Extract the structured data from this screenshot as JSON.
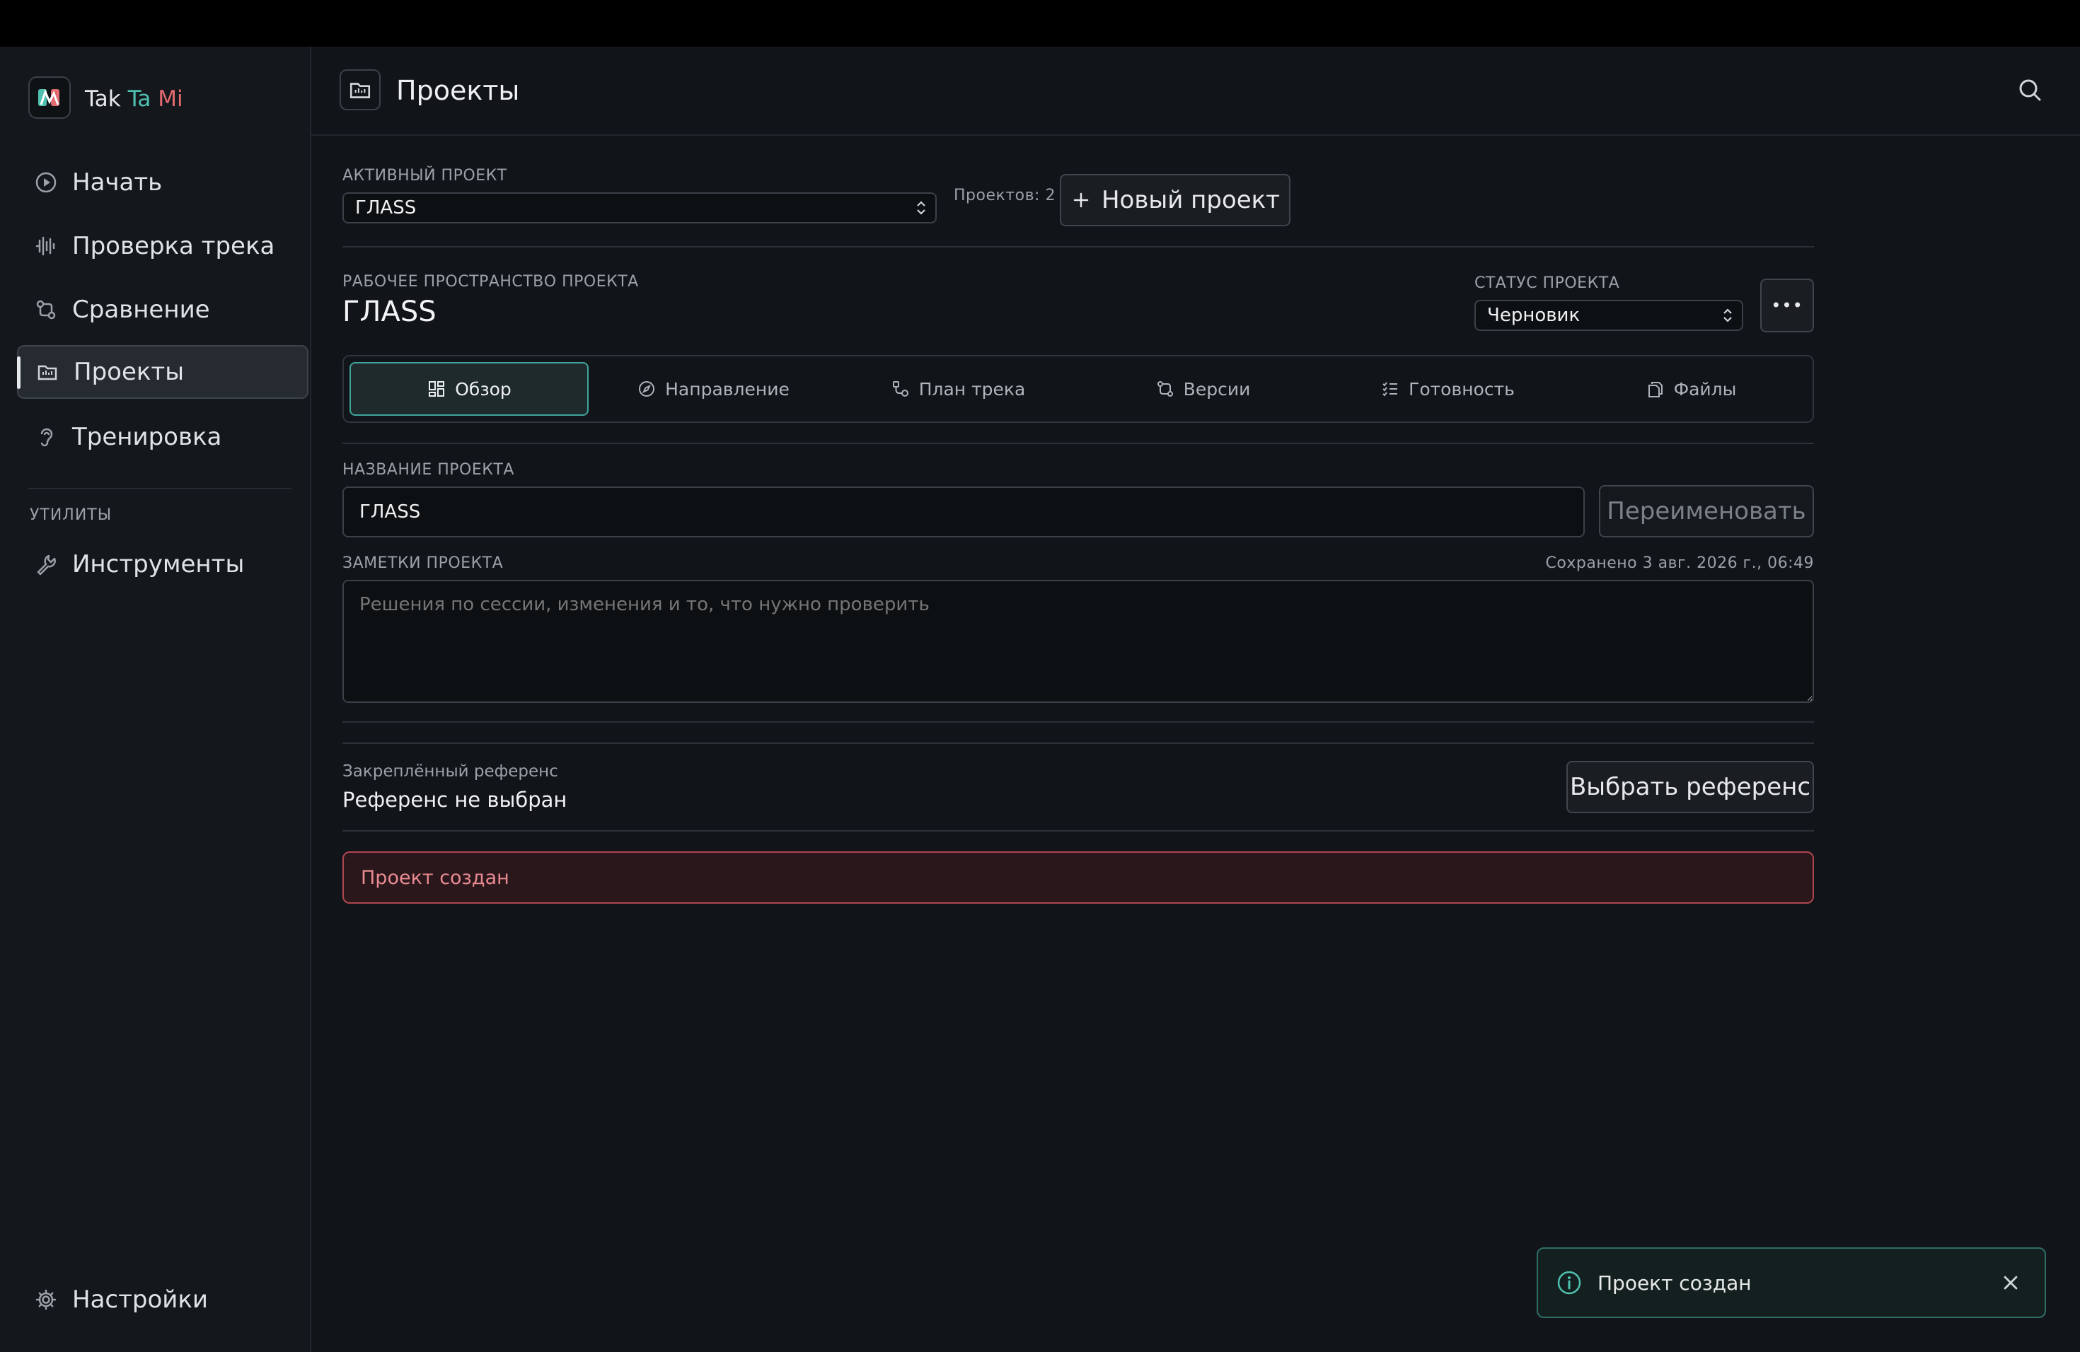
{
  "brand": {
    "word1": "Tak",
    "word2": "Ta",
    "word3": "Mi"
  },
  "sidebar": {
    "items": [
      {
        "label": "Начать",
        "icon": "play-circle-icon"
      },
      {
        "label": "Проверка трека",
        "icon": "waveform-icon"
      },
      {
        "label": "Сравнение",
        "icon": "compare-icon"
      },
      {
        "label": "Проекты",
        "icon": "folder-icon",
        "active": true
      },
      {
        "label": "Тренировка",
        "icon": "ear-icon"
      }
    ],
    "utilities_label": "УТИЛИТЫ",
    "utilities": [
      {
        "label": "Инструменты",
        "icon": "wrench-icon"
      }
    ],
    "settings_label": "Настройки"
  },
  "header": {
    "title": "Проекты"
  },
  "active_project": {
    "label": "АКТИВНЫЙ ПРОЕКТ",
    "value": "ГЛАSS",
    "count_text": "Проектов: 2",
    "new_button": "Новый проект"
  },
  "workspace": {
    "label": "РАБОЧЕЕ ПРОСТРАНСТВО ПРОЕКТА",
    "title": "ГЛАSS",
    "status_label": "СТАТУС ПРОЕКТА",
    "status_value": "Черновик",
    "more_label": "•••"
  },
  "tabs": [
    {
      "label": "Обзор",
      "icon": "grid-icon",
      "active": true
    },
    {
      "label": "Направление",
      "icon": "compass-icon"
    },
    {
      "label": "План трека",
      "icon": "route-icon"
    },
    {
      "label": "Версии",
      "icon": "versions-icon"
    },
    {
      "label": "Готовность",
      "icon": "checklist-icon"
    },
    {
      "label": "Файлы",
      "icon": "files-icon"
    }
  ],
  "project_name": {
    "label": "НАЗВАНИЕ ПРОЕКТА",
    "value": "ГЛАSS",
    "rename_button": "Переименовать"
  },
  "notes": {
    "label": "ЗАМЕТКИ ПРОЕКТА",
    "saved_text": "Сохранено 3 авг. 2026 г., 06:49",
    "placeholder": "Решения по сессии, изменения и то, что нужно проверить"
  },
  "reference": {
    "label": "Закреплённый референс",
    "value": "Референс не выбран",
    "button": "Выбрать референс"
  },
  "notice": {
    "text": "Проект создан"
  },
  "toast": {
    "text": "Проект создан"
  },
  "colors": {
    "accent": "#3fa69a",
    "brand_teal": "#4fc1b0",
    "brand_red": "#e26a70",
    "danger": "#b0454f"
  }
}
